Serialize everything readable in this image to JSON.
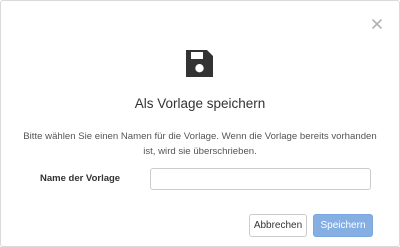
{
  "dialog": {
    "close_icon": "close-icon",
    "header_icon": "floppy-disk-save-icon",
    "title": "Als Vorlage speichern",
    "description": "Bitte wählen Sie einen Namen für die Vorlage. Wenn die Vorlage bereits vorhanden ist, wird sie überschrieben.",
    "field": {
      "label": "Name der Vorlage",
      "value": ""
    },
    "buttons": {
      "cancel_label": "Abbrechen",
      "save_label": "Speichern"
    }
  },
  "colors": {
    "primary_button": "#85aee3",
    "icon": "#333333",
    "close_icon": "#b3b3b3"
  }
}
